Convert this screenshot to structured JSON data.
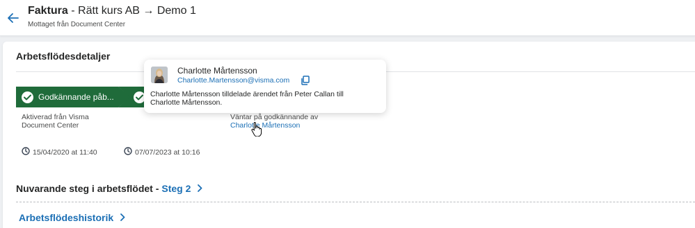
{
  "header": {
    "title_bold": "Faktura",
    "title_rest": " - Rätt kurs AB → Demo 1",
    "subtitle": "Mottaget från Document Center"
  },
  "workflow": {
    "section_title": "Arbetsflödesdetaljer",
    "steps": [
      {
        "label": "Godkännande påb...",
        "info": "Aktiverad från Visma Document Center",
        "date": "15/04/2020 at 11:40"
      },
      {
        "label": "",
        "info_prefix": "Väntar på godkännande av",
        "info_link": "Charlotte Mårtensson",
        "date": "07/07/2023 at 10:16"
      }
    ]
  },
  "popover": {
    "name": "Charlotte Mårtensson",
    "email": "Charlotte.Martensson@visma.com",
    "message": "Charlotte Mårtensson tilldelade ärendet från Peter Callan till Charlotte Mårtensson."
  },
  "current_step": {
    "label": "Nuvarande steg i arbetsflödet -",
    "step": "Steg 2"
  },
  "history": {
    "label": "Arbetsflödeshistorik"
  },
  "colors": {
    "accent": "#1b6fb5",
    "step_green": "#1f6b3a",
    "background": "#eef0f3"
  }
}
